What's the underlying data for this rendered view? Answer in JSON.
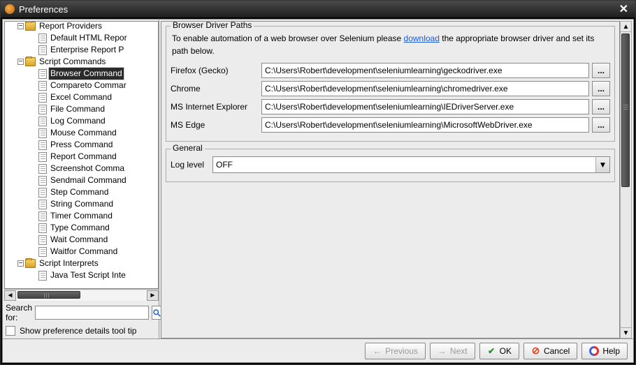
{
  "window": {
    "title": "Preferences"
  },
  "tree": {
    "items": [
      {
        "level": 1,
        "type": "folder",
        "toggle": "minus",
        "label": "Report Providers"
      },
      {
        "level": 2,
        "type": "file",
        "label": "Default HTML Repor"
      },
      {
        "level": 2,
        "type": "file",
        "label": "Enterprise Report P"
      },
      {
        "level": 1,
        "type": "folder",
        "toggle": "minus",
        "label": "Script Commands"
      },
      {
        "level": 2,
        "type": "file",
        "label": "Browser Command",
        "selected": true
      },
      {
        "level": 2,
        "type": "file",
        "label": "Compareto Commar"
      },
      {
        "level": 2,
        "type": "file",
        "label": "Excel Command"
      },
      {
        "level": 2,
        "type": "file",
        "label": "File Command"
      },
      {
        "level": 2,
        "type": "file",
        "label": "Log Command"
      },
      {
        "level": 2,
        "type": "file",
        "label": "Mouse Command"
      },
      {
        "level": 2,
        "type": "file",
        "label": "Press Command"
      },
      {
        "level": 2,
        "type": "file",
        "label": "Report Command"
      },
      {
        "level": 2,
        "type": "file",
        "label": "Screenshot Comma"
      },
      {
        "level": 2,
        "type": "file",
        "label": "Sendmail Command"
      },
      {
        "level": 2,
        "type": "file",
        "label": "Step Command"
      },
      {
        "level": 2,
        "type": "file",
        "label": "String Command"
      },
      {
        "level": 2,
        "type": "file",
        "label": "Timer Command"
      },
      {
        "level": 2,
        "type": "file",
        "label": "Type Command"
      },
      {
        "level": 2,
        "type": "file",
        "label": "Wait Command"
      },
      {
        "level": 2,
        "type": "file",
        "label": "Waitfor Command"
      },
      {
        "level": 1,
        "type": "folder",
        "toggle": "minus",
        "label": "Script Interprets"
      },
      {
        "level": 2,
        "type": "file",
        "label": "Java Test Script Inte"
      }
    ]
  },
  "search": {
    "label": "Search for:",
    "value": ""
  },
  "tip": {
    "label": "Show preference details tool tip"
  },
  "panel": {
    "group1": {
      "title": "Browser Driver Paths",
      "help_before": "To enable automation of a web browser over Selenium please ",
      "help_link": "download",
      "help_after": " the appropriate browser driver and set its path below.",
      "rows": [
        {
          "label": "Firefox (Gecko)",
          "value": "C:\\Users\\Robert\\development\\seleniumlearning\\geckodriver.exe"
        },
        {
          "label": "Chrome",
          "value": "C:\\Users\\Robert\\development\\seleniumlearning\\chromedriver.exe"
        },
        {
          "label": "MS Internet Explorer",
          "value": "C:\\Users\\Robert\\development\\seleniumlearning\\IEDriverServer.exe"
        },
        {
          "label": "MS Edge",
          "value": "C:\\Users\\Robert\\development\\seleniumlearning\\MicrosoftWebDriver.exe"
        }
      ],
      "browse": "..."
    },
    "group2": {
      "title": "General",
      "loglevel_label": "Log level",
      "loglevel_value": "OFF"
    }
  },
  "footer": {
    "previous": "Previous",
    "next": "Next",
    "ok": "OK",
    "cancel": "Cancel",
    "help": "Help"
  }
}
